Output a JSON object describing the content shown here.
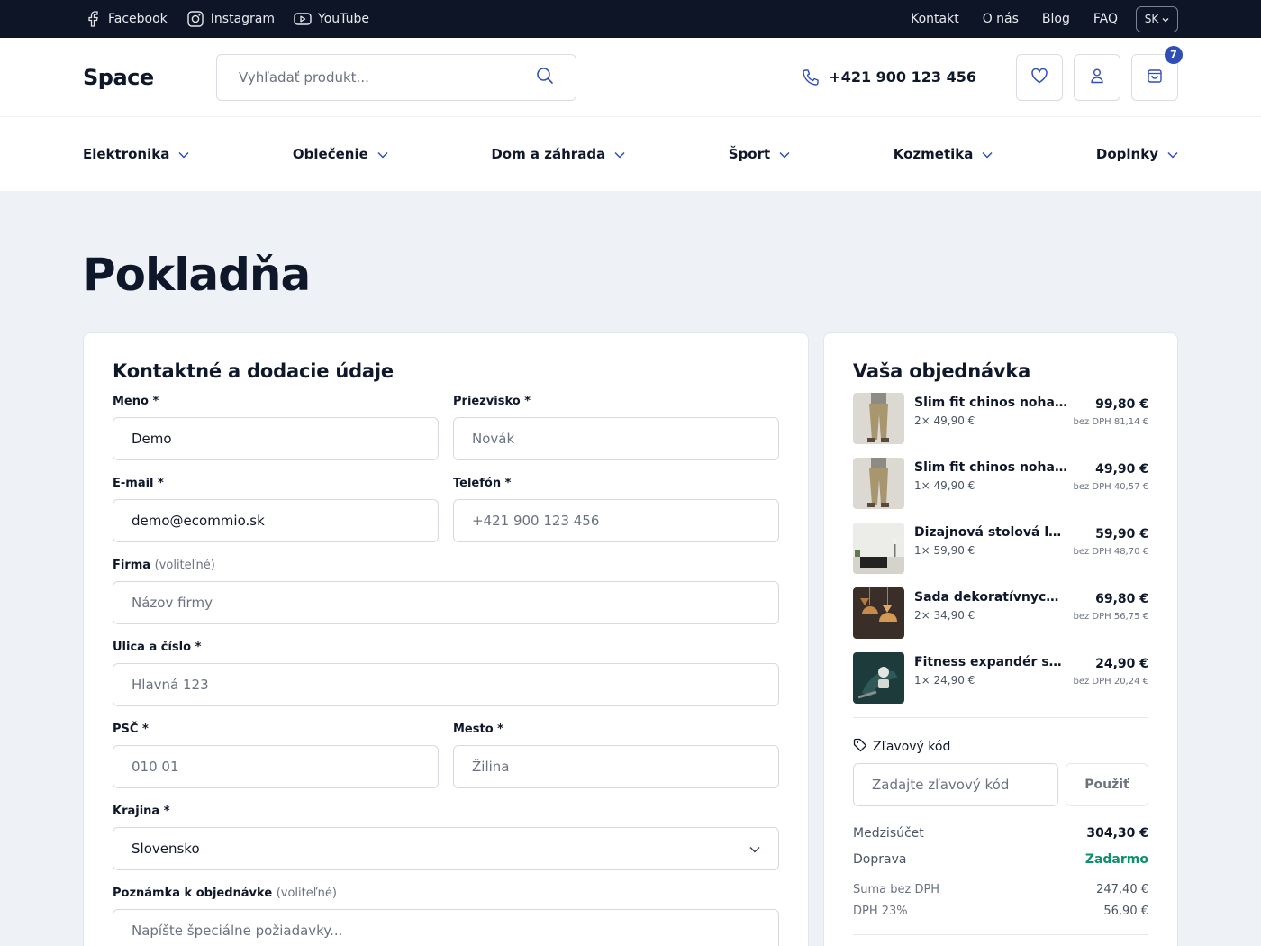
{
  "topbar": {
    "social": [
      {
        "label": "Facebook",
        "icon": "facebook-icon"
      },
      {
        "label": "Instagram",
        "icon": "instagram-icon"
      },
      {
        "label": "YouTube",
        "icon": "youtube-icon"
      }
    ],
    "links": [
      "Kontakt",
      "O nás",
      "Blog",
      "FAQ"
    ],
    "language": "SK"
  },
  "header": {
    "logo": "Space",
    "search_placeholder": "Vyhľadať produkt...",
    "phone": "+421 900 123 456",
    "cart_count": "7"
  },
  "nav": [
    "Elektronika",
    "Oblečenie",
    "Dom a záhrada",
    "Šport",
    "Kozmetika",
    "Doplnky"
  ],
  "page_title": "Pokladňa",
  "form": {
    "title": "Kontaktné a dodacie údaje",
    "first_name": {
      "label": "Meno *",
      "value": "Demo"
    },
    "last_name": {
      "label": "Priezvisko *",
      "placeholder": "Novák"
    },
    "email": {
      "label": "E-mail *",
      "value": "demo@ecommio.sk"
    },
    "phone": {
      "label": "Telefón *",
      "placeholder": "+421 900 123 456"
    },
    "company": {
      "label": "Firma",
      "optional": "(voliteľné)",
      "placeholder": "Názov firmy"
    },
    "street": {
      "label": "Ulica a číslo *",
      "placeholder": "Hlavná 123"
    },
    "zip": {
      "label": "PSČ *",
      "placeholder": "010 01"
    },
    "city": {
      "label": "Mesto *",
      "placeholder": "Žilina"
    },
    "country": {
      "label": "Krajina *",
      "value": "Slovensko"
    },
    "note": {
      "label": "Poznámka k objednávke",
      "optional": "(voliteľné)",
      "placeholder": "Napíšte špeciálne požiadavky..."
    }
  },
  "order": {
    "title": "Vaša objednávka",
    "items": [
      {
        "name": "Slim fit chinos nohavice",
        "qty": "2× 49,90 €",
        "price": "99,80 €",
        "net": "bez DPH 81,14 €"
      },
      {
        "name": "Slim fit chinos nohavice",
        "qty": "1× 49,90 €",
        "price": "49,90 €",
        "net": "bez DPH 40,57 €"
      },
      {
        "name": "Dizajnová stolová lamp...",
        "qty": "1× 59,90 €",
        "price": "59,90 €",
        "net": "bez DPH 48,70 €"
      },
      {
        "name": "Sada dekoratívnych va...",
        "qty": "2× 34,90 €",
        "price": "69,80 €",
        "net": "bez DPH 56,75 €"
      },
      {
        "name": "Fitness expandér sada ...",
        "qty": "1× 24,90 €",
        "price": "24,90 €",
        "net": "bez DPH 20,24 €"
      }
    ],
    "discount_label": "Zľavový kód",
    "discount_placeholder": "Zadajte zľavový kód",
    "discount_button": "Použiť",
    "subtotal_label": "Medzisúčet",
    "subtotal": "304,30 €",
    "shipping_label": "Doprava",
    "shipping": "Zadarmo",
    "net_label": "Suma bez DPH",
    "net": "247,40 €",
    "vat_label": "DPH 23%",
    "vat": "56,90 €"
  }
}
